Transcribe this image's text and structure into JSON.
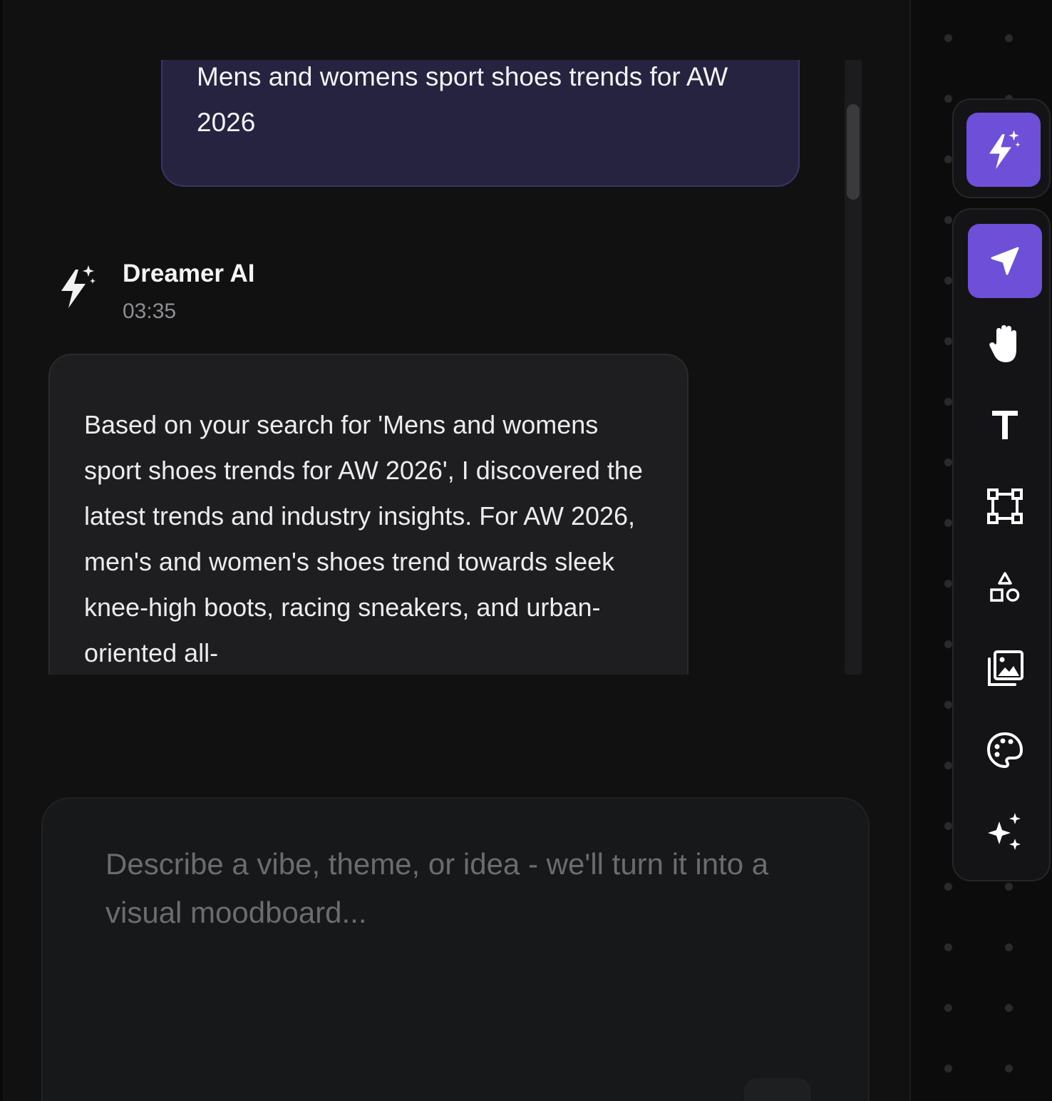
{
  "chat": {
    "user_message": {
      "text": "Mens and womens sport shoes trends for AW 2026"
    },
    "ai_message": {
      "sender": "Dreamer AI",
      "time": "03:35",
      "text": "Based on your search for 'Mens and womens sport shoes trends for AW 2026', I discovered the latest trends and industry insights. For AW 2026, men's and women's shoes trend towards sleek knee-high boots, racing sneakers, and urban-oriented all-"
    },
    "input": {
      "value": "",
      "placeholder": "Describe a vibe, theme, or idea - we'll turn it into a visual moodboard..."
    }
  },
  "toolbar": {
    "top_tool": {
      "icon": "lightning-sparkle-icon",
      "active": true
    },
    "tools": [
      {
        "icon": "select-arrow-icon",
        "active": true
      },
      {
        "icon": "hand-icon",
        "active": false
      },
      {
        "icon": "text-icon",
        "active": false
      },
      {
        "icon": "frame-icon",
        "active": false
      },
      {
        "icon": "shapes-icon",
        "active": false
      },
      {
        "icon": "image-gallery-icon",
        "active": false
      },
      {
        "icon": "palette-icon",
        "active": false
      },
      {
        "icon": "sparkles-icon",
        "active": false
      }
    ]
  },
  "colors": {
    "accent": "#6e4fd8",
    "user_bubble": "#262340",
    "ai_bubble": "#1e1e20",
    "background": "#111112"
  }
}
